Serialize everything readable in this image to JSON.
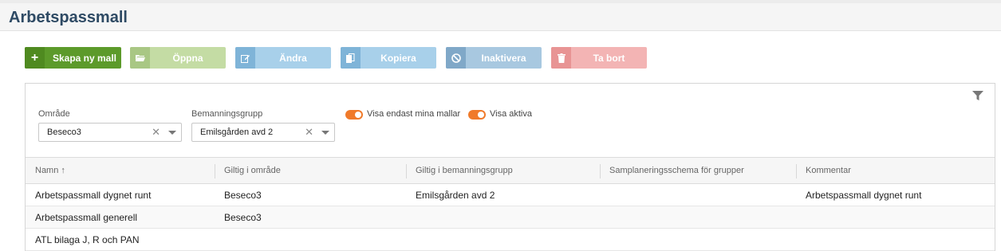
{
  "page": {
    "title": "Arbetspassmall"
  },
  "toolbar": {
    "new_label": "Skapa ny mall",
    "open_label": "Öppna",
    "edit_label": "Ändra",
    "copy_label": "Kopiera",
    "inactivate_label": "Inaktivera",
    "delete_label": "Ta bort"
  },
  "filters": {
    "area": {
      "label": "Område",
      "value": "Beseco3"
    },
    "group": {
      "label": "Bemanningsgrupp",
      "value": "Emilsgården avd 2"
    },
    "only_mine": {
      "label": "Visa endast mina mallar",
      "on": true
    },
    "show_active": {
      "label": "Visa aktiva",
      "on": true
    }
  },
  "grid": {
    "columns": [
      "Namn ↑",
      "Giltig i område",
      "Giltig i bemanningsgrupp",
      "Samplaneringsschema för grupper",
      "Kommentar"
    ],
    "rows": [
      [
        "Arbetspassmall dygnet runt",
        "Beseco3",
        "Emilsgården avd 2",
        "",
        "Arbetspassmall dygnet runt"
      ],
      [
        "Arbetspassmall generell",
        "Beseco3",
        "",
        "",
        ""
      ],
      [
        "ATL bilaga J, R och PAN",
        "",
        "",
        "",
        ""
      ]
    ]
  },
  "colors": {
    "title": "#2e4a64",
    "new_button": "#5c9a2a",
    "toggle_on": "#f07a2a"
  }
}
